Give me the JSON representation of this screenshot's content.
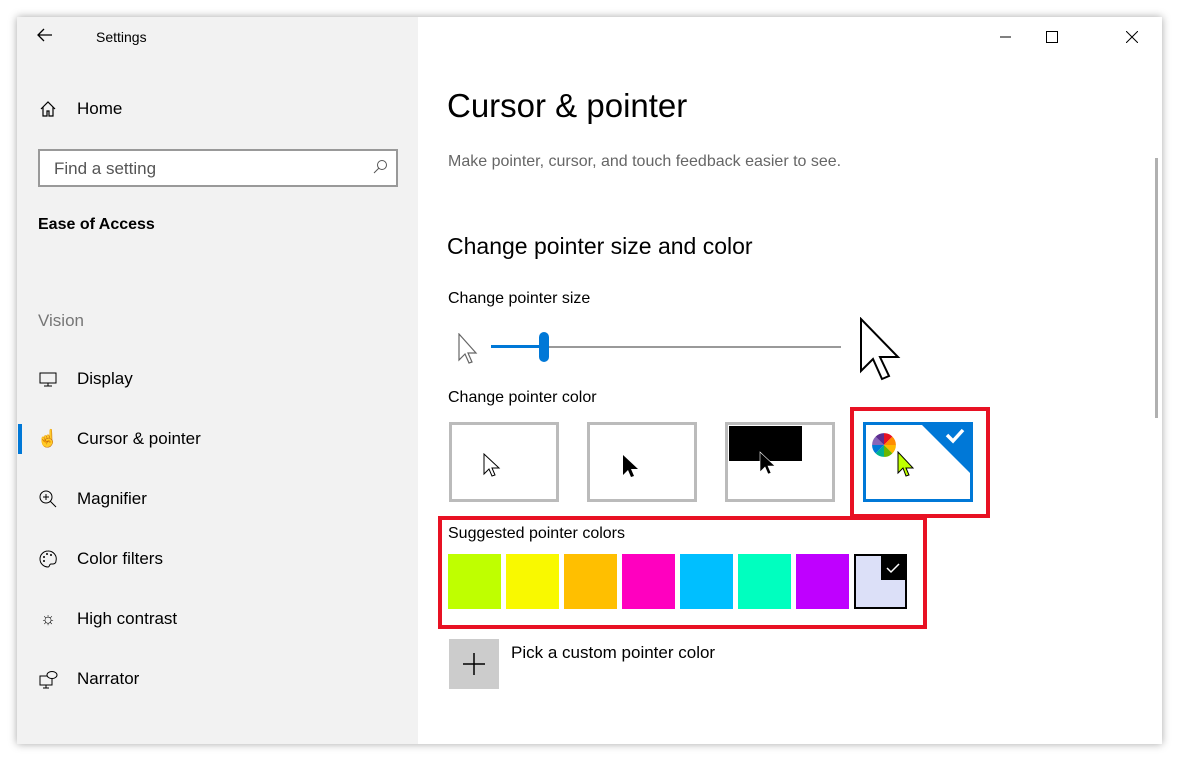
{
  "window": {
    "title": "Settings",
    "back_icon": "arrow-left-icon",
    "controls": [
      "minimize-icon",
      "maximize-icon",
      "close-icon"
    ]
  },
  "sidebar": {
    "home": "Home",
    "search": {
      "placeholder": "Find a setting",
      "icon": "search-icon"
    },
    "section": "Ease of Access",
    "group": "Vision",
    "items": [
      {
        "label": "Display",
        "icon": "monitor-icon"
      },
      {
        "label": "Cursor & pointer",
        "icon": "cursor-hand-icon",
        "selected": true
      },
      {
        "label": "Magnifier",
        "icon": "magnifier-icon"
      },
      {
        "label": "Color filters",
        "icon": "palette-icon"
      },
      {
        "label": "High contrast",
        "icon": "sun-icon"
      },
      {
        "label": "Narrator",
        "icon": "narrator-icon"
      }
    ]
  },
  "main": {
    "title": "Cursor & pointer",
    "description": "Make pointer, cursor, and touch feedback easier to see.",
    "section_title": "Change pointer size and color",
    "size_label": "Change pointer size",
    "size_slider_fraction": 0.15,
    "color_label": "Change pointer color",
    "color_options": [
      {
        "name": "white",
        "selected": false
      },
      {
        "name": "black",
        "selected": false
      },
      {
        "name": "inverted",
        "selected": false
      },
      {
        "name": "custom",
        "selected": true
      }
    ],
    "suggested_label": "Suggested pointer colors",
    "suggested_colors": [
      "#bfff00",
      "#f9f900",
      "#ffbf00",
      "#ff00bf",
      "#00bfff",
      "#00ffbf",
      "#bf00ff",
      "#dce0f8"
    ],
    "selected_suggested_index": 7,
    "custom_label": "Pick a custom pointer color",
    "accent": "#0078d7",
    "highlight": "#e81123"
  }
}
